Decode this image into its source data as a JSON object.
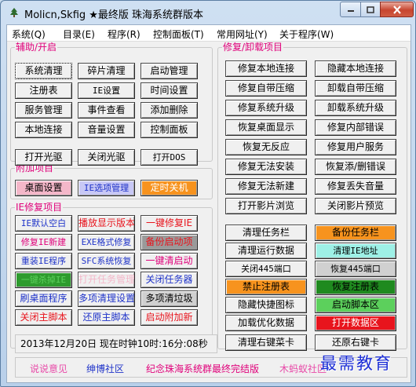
{
  "window": {
    "title": "Molicn,Skfig ★最终版 珠海系统群版本",
    "icon": "tree-icon"
  },
  "menu": [
    "系统(Q)",
    "目录(E)",
    "程序(R)",
    "控制面板(T)",
    "常用网址(Y)",
    "关于程序(W)"
  ],
  "groups": {
    "assist": "辅助/开启",
    "repair": "修复/卸载项目",
    "extra": "附加项目",
    "ie": "IE修复项目"
  },
  "assist_buttons": [
    "系统清理",
    "碎片清理",
    "启动管理",
    "注册表",
    "IE设置",
    "时间设置",
    "服务管理",
    "事件查看",
    "添加删除",
    "本地连接",
    "音量设置",
    "控制面板",
    "打开光驱",
    "关闭光驱",
    "打开DOS"
  ],
  "extra_buttons": [
    "桌面设置",
    "IE选项管理",
    "定时关机"
  ],
  "ie_buttons": [
    "IE默认空白",
    "播放显示版本",
    "一键修复IE",
    "修复IE新建",
    "EXE格式修复",
    "备份启动项",
    "重装IE程序",
    "SFC系统恢复",
    "一键清启动",
    "一键杀掉IE",
    "打开任务管理",
    "关闭任务器",
    "刷桌面程序",
    "多项清理设置",
    "多项清垃圾",
    "关闭主脚本",
    "还原主脚本",
    "启动附加新"
  ],
  "repair_buttons": [
    "修复本地连接",
    "隐藏本地连接",
    "修复自带压缩",
    "卸载自带压缩",
    "修复系统升级",
    "卸载系统升级",
    "恢复桌面显示",
    "修复内部错误",
    "恢复无反应",
    "修复用户服务",
    "修复无法安装",
    "恢复添/删错误",
    "修复无法新建",
    "修复丢失音量",
    "打开影片浏览",
    "关闭影片预览"
  ],
  "lower_buttons": [
    "清理任务栏",
    "备份任务栏",
    "清理运行数据",
    "清理IE地址",
    "关闭445端口",
    "恢复445端口",
    "禁止注册表",
    "恢复注册表",
    "隐藏快捷图标",
    "启动脚本区",
    "加载优化数据",
    "打开数据区",
    "清理右键菜卡",
    "还原右键卡"
  ],
  "status": "2013年12月20日 现在时钟10时:16分:08秒",
  "footer": [
    "说说意见",
    "绅博社区",
    "纪念珠海系统群最终完结版",
    "木蚂蚁社区"
  ],
  "watermark": "最需教育",
  "colors": {
    "legend": "#e0007a",
    "button_face": "#f0f0f0",
    "pink": "#f4b7c9",
    "lavender": "#c8c8f5",
    "orange": "#f7931e",
    "green": "#2e9b2e",
    "dark_green": "#1f8a1f",
    "gray": "#9a9a9a",
    "red_text": "#e8141d",
    "blue_text": "#1f33c9",
    "magenta_text": "#e0007a",
    "light_green": "#5cd05c",
    "light_cyan": "#9ef0e6",
    "footer_pink": "#e84aa8"
  }
}
